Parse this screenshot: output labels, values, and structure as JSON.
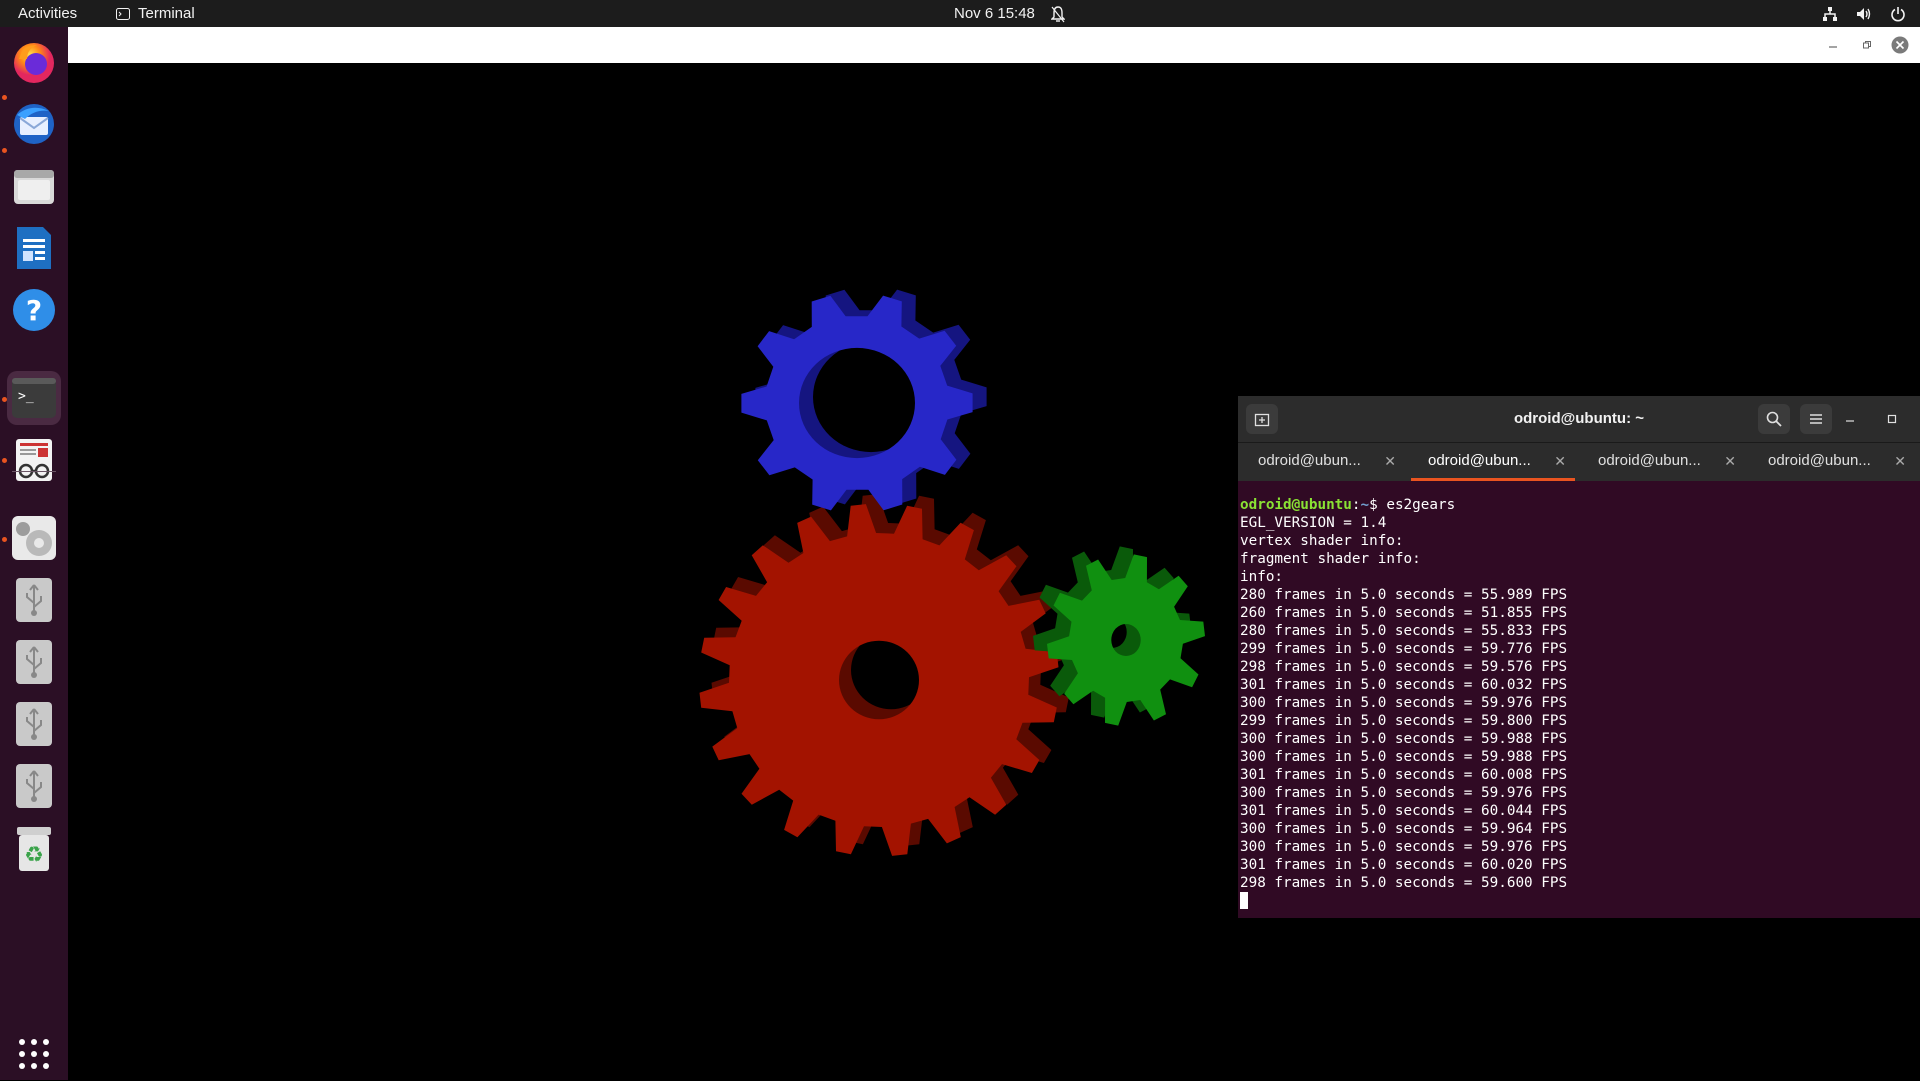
{
  "topbar": {
    "activities": "Activities",
    "app_name": "Terminal",
    "clock": "Nov 6  15:48"
  },
  "dock": {
    "items": [
      {
        "name": "firefox",
        "icon": "firefox-icon"
      },
      {
        "name": "thunderbird",
        "icon": "thunderbird-icon"
      },
      {
        "name": "files",
        "icon": "files-icon"
      },
      {
        "name": "libreoffice-writer",
        "icon": "writer-icon"
      },
      {
        "name": "help",
        "icon": "help-icon",
        "label": "?"
      },
      {
        "name": "terminal",
        "icon": "terminal-icon",
        "label": ">_"
      },
      {
        "name": "document-viewer",
        "icon": "document-viewer-icon"
      },
      {
        "name": "system-settings",
        "icon": "settings-icon"
      },
      {
        "name": "usb-drive-1",
        "icon": "usb-icon"
      },
      {
        "name": "usb-drive-2",
        "icon": "usb-icon"
      },
      {
        "name": "usb-drive-3",
        "icon": "usb-icon"
      },
      {
        "name": "usb-drive-4",
        "icon": "usb-icon"
      },
      {
        "name": "trash",
        "icon": "trash-icon",
        "label": "♻"
      }
    ],
    "apps_grid_icon": "show-apps-icon"
  },
  "colors": {
    "topbar": "#1c1c1c",
    "dock": "#2b0f25",
    "terminal_bg": "#300a24",
    "accent": "#e95420",
    "gear_red": "#a31300",
    "gear_green": "#109010",
    "gear_blue": "#2727c8",
    "prompt_user": "#8ae234",
    "prompt_path": "#729fcf"
  },
  "terminal": {
    "title": "odroid@ubuntu: ~",
    "tabs": [
      {
        "label": "odroid@ubun...",
        "active": false
      },
      {
        "label": "odroid@ubun...",
        "active": true
      },
      {
        "label": "odroid@ubun...",
        "active": false
      },
      {
        "label": "odroid@ubun...",
        "active": false
      }
    ],
    "prompt_user": "odroid@ubuntu",
    "prompt_sep": ":",
    "prompt_path": "~",
    "prompt_cmd": "$ es2gears",
    "output": [
      "EGL_VERSION = 1.4",
      "vertex shader info:",
      "fragment shader info:",
      "info:",
      "280 frames in 5.0 seconds = 55.989 FPS",
      "260 frames in 5.0 seconds = 51.855 FPS",
      "280 frames in 5.0 seconds = 55.833 FPS",
      "299 frames in 5.0 seconds = 59.776 FPS",
      "298 frames in 5.0 seconds = 59.576 FPS",
      "301 frames in 5.0 seconds = 60.032 FPS",
      "300 frames in 5.0 seconds = 59.976 FPS",
      "299 frames in 5.0 seconds = 59.800 FPS",
      "300 frames in 5.0 seconds = 59.988 FPS",
      "300 frames in 5.0 seconds = 59.988 FPS",
      "301 frames in 5.0 seconds = 60.008 FPS",
      "300 frames in 5.0 seconds = 59.976 FPS",
      "301 frames in 5.0 seconds = 60.044 FPS",
      "300 frames in 5.0 seconds = 59.964 FPS",
      "300 frames in 5.0 seconds = 59.976 FPS",
      "301 frames in 5.0 seconds = 60.020 FPS",
      "298 frames in 5.0 seconds = 59.600 FPS"
    ]
  }
}
